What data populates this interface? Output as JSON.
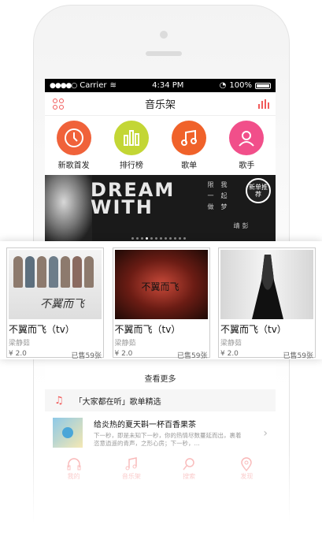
{
  "status": {
    "carrier": "Carrier",
    "time": "4:34 PM",
    "battery": "100%"
  },
  "header": {
    "title": "音乐架"
  },
  "quick": [
    {
      "label": "新歌首发",
      "color": "#f0623a",
      "icon": "clock-icon"
    },
    {
      "label": "排行榜",
      "color": "#c3d635",
      "icon": "chart-bars-icon"
    },
    {
      "label": "歌单",
      "color": "#f0622a",
      "icon": "music-note-icon"
    },
    {
      "label": "歌手",
      "color": "#f14f8a",
      "icon": "user-icon"
    }
  ],
  "banner": {
    "headline": "DREAM WITH",
    "vert1": "限一做",
    "vert2": "我起梦",
    "vert3": "彭靖",
    "badge": "新单推荐"
  },
  "albums": [
    {
      "title": "不翼而飞（tv）",
      "artist": "梁静茹",
      "price": "¥ 2.0",
      "sold": "已售59张",
      "cover_text": "不翼而飞"
    },
    {
      "title": "不翼而飞（tv）",
      "artist": "梁静茹",
      "price": "¥ 2.0",
      "sold": "已售59张",
      "cover_text": "不翼而飞"
    },
    {
      "title": "不翼而飞（tv）",
      "artist": "梁静茹",
      "price": "¥ 2.0",
      "sold": "已售59张",
      "cover_text": ""
    }
  ],
  "more_label": "查看更多",
  "section": {
    "title": "「大家都在听」歌单精选"
  },
  "song": {
    "title": "给炎热的夏天斟一杯百香果茶",
    "desc": "下一秒，即是未知下一秒，你的热情尽数蔓延而出，裹着恣意逍遥的青声，之形心房；下一秒，..."
  },
  "tabs": [
    {
      "label": "我的",
      "icon": "headphones-icon"
    },
    {
      "label": "音乐架",
      "icon": "music-note-icon"
    },
    {
      "label": "搜索",
      "icon": "search-icon"
    },
    {
      "label": "发现",
      "icon": "location-pin-icon"
    }
  ],
  "accent": "#f15a5a"
}
